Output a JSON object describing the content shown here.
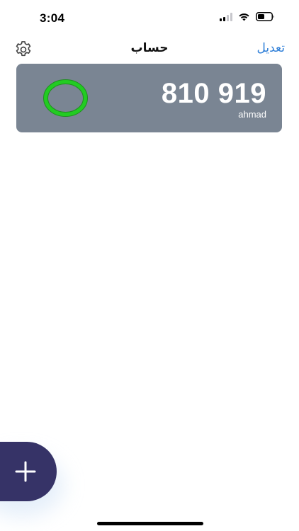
{
  "status_bar": {
    "time": "3:04",
    "signal_icon": "cellular-signal-icon",
    "wifi_icon": "wifi-icon",
    "battery_icon": "battery-icon"
  },
  "nav": {
    "settings_icon": "gear-icon",
    "title": "حساب",
    "edit_label": "تعديل"
  },
  "accounts": [
    {
      "code": "810 919",
      "name": "ahmad",
      "timer_icon": "countdown-ring-icon",
      "timer_color": "#22cc22"
    }
  ],
  "fab": {
    "icon": "plus-icon"
  },
  "colors": {
    "accent": "#2f7fd8",
    "card_background": "#7a8593",
    "fab_background": "#363367",
    "timer_ring": "#22cc22"
  }
}
